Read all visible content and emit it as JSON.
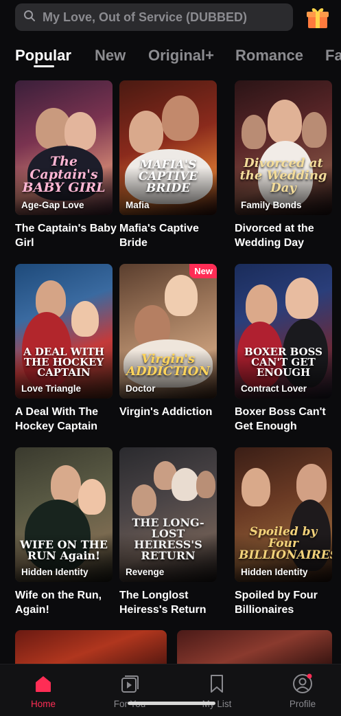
{
  "search": {
    "placeholder": "My Love, Out of Service (DUBBED)",
    "icon": "search-icon"
  },
  "gift": {
    "icon": "gift-icon"
  },
  "tabs": [
    {
      "label": "Popular",
      "active": true
    },
    {
      "label": "New",
      "active": false
    },
    {
      "label": "Original+",
      "active": false
    },
    {
      "label": "Romance",
      "active": false
    },
    {
      "label": "Fa",
      "active": false
    }
  ],
  "dramas": [
    {
      "title": "The Captain's Baby Girl",
      "genre": "Age-Gap Love",
      "poster_text": "The Captain's BABY GIRL",
      "badge": ""
    },
    {
      "title": "Mafia's Captive Bride",
      "genre": "Mafia",
      "poster_text": "MAFIA'S CAPTIVE BRIDE",
      "badge": ""
    },
    {
      "title": "Divorced at the Wedding Day",
      "genre": "Family Bonds",
      "poster_text": "Divorced at the Wedding Day",
      "badge": ""
    },
    {
      "title": "A Deal With The Hockey Captain",
      "genre": "Love Triangle",
      "poster_text": "A DEAL WITH THE HOCKEY CAPTAIN",
      "badge": ""
    },
    {
      "title": "Virgin's Addiction",
      "genre": "Doctor",
      "poster_text": "Virgin's ADDICTION",
      "badge": "New"
    },
    {
      "title": "Boxer Boss Can't Get Enough",
      "genre": "Contract Lover",
      "poster_text": "BOXER BOSS CAN'T GET ENOUGH",
      "badge": ""
    },
    {
      "title": "Wife on the Run, Again!",
      "genre": "Hidden Identity",
      "poster_text": "WIFE ON THE RUN Again!",
      "badge": ""
    },
    {
      "title": "The Longlost Heiress's Return",
      "genre": "Revenge",
      "poster_text": "THE LONG-LOST HEIRESS'S RETURN",
      "badge": ""
    },
    {
      "title": "Spoiled by Four Billionaires",
      "genre": "Hidden Identity",
      "poster_text": "Spoiled by Four BILLIONAIRES",
      "badge": ""
    }
  ],
  "nav": [
    {
      "label": "Home",
      "icon": "home-icon",
      "active": true
    },
    {
      "label": "For You",
      "icon": "play-stack-icon",
      "active": false
    },
    {
      "label": "My List",
      "icon": "bookmark-icon",
      "active": false
    },
    {
      "label": "Profile",
      "icon": "profile-icon",
      "active": false
    }
  ],
  "colors": {
    "accent": "#ff2d55",
    "background": "#0b0b0d",
    "search_bg": "#2b2b2e",
    "inactive": "#8c8c90"
  }
}
